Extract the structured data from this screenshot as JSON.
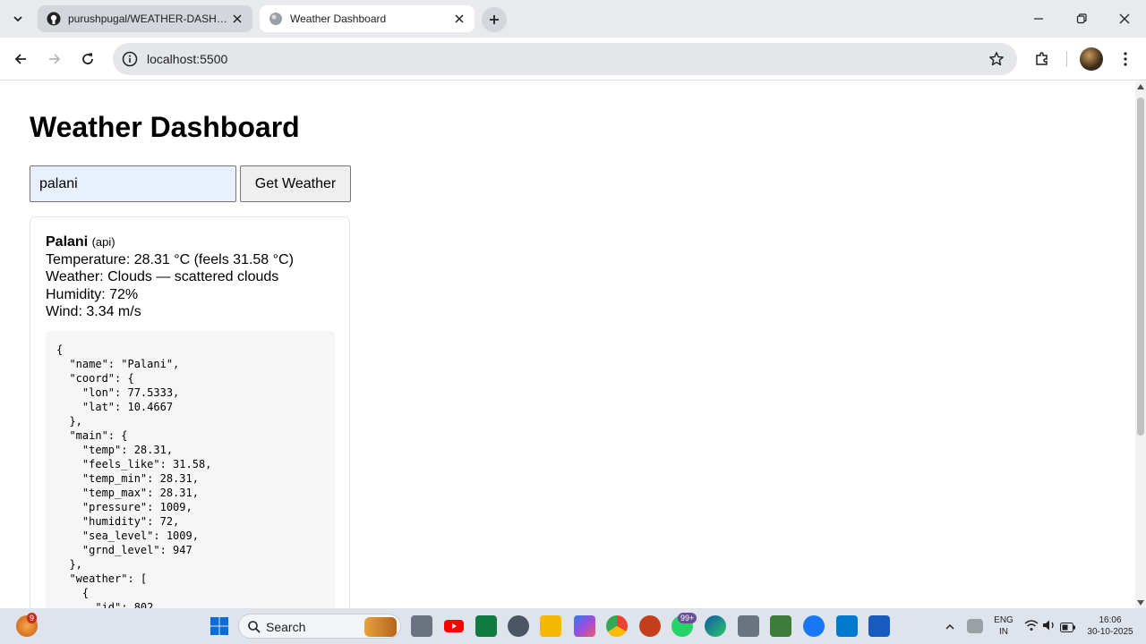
{
  "browser": {
    "tabs": [
      {
        "title": "purushpugal/WEATHER-DASHBOARD",
        "active": false
      },
      {
        "title": "Weather Dashboard",
        "active": true
      }
    ],
    "url": "localhost:5500"
  },
  "page": {
    "title": "Weather Dashboard",
    "search": {
      "value": "palani"
    },
    "button_label": "Get Weather",
    "result": {
      "city": "Palani",
      "source": "(api)",
      "temperature_line": "Temperature: 28.31 °C (feels 31.58 °C)",
      "weather_line": "Weather: Clouds — scattered clouds",
      "humidity_line": "Humidity: 72%",
      "wind_line": "Wind: 3.34 m/s",
      "raw_json": "{\n  \"name\": \"Palani\",\n  \"coord\": {\n    \"lon\": 77.5333,\n    \"lat\": 10.4667\n  },\n  \"main\": {\n    \"temp\": 28.31,\n    \"feels_like\": 31.58,\n    \"temp_min\": 28.31,\n    \"temp_max\": 28.31,\n    \"pressure\": 1009,\n    \"humidity\": 72,\n    \"sea_level\": 1009,\n    \"grnd_level\": 947\n  },\n  \"weather\": [\n    {\n      \"id\": 802"
    }
  },
  "taskbar": {
    "search_label": "Search",
    "notification_badge": "9",
    "whatsapp_badge": "99+",
    "language": "ENG",
    "region": "IN",
    "time": "16:06",
    "date": "30-10-2025"
  },
  "colors": {
    "accent": "#1a73e8",
    "input_autofill_bg": "#e8f0fe"
  }
}
